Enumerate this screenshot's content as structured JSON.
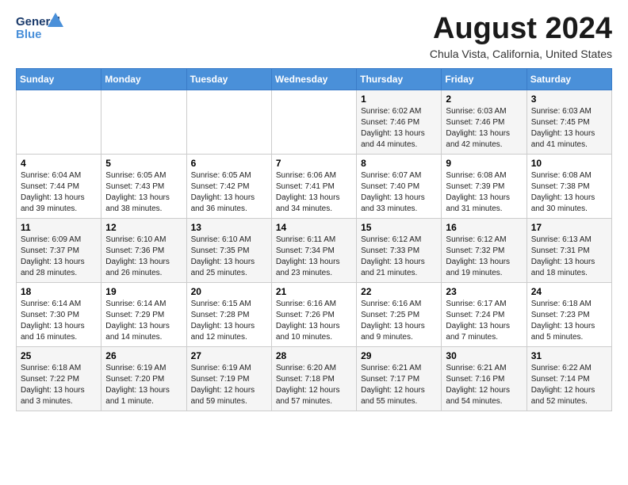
{
  "header": {
    "logo_line1": "General",
    "logo_line2": "Blue",
    "month_title": "August 2024",
    "location": "Chula Vista, California, United States"
  },
  "weekdays": [
    "Sunday",
    "Monday",
    "Tuesday",
    "Wednesday",
    "Thursday",
    "Friday",
    "Saturday"
  ],
  "weeks": [
    [
      {
        "day": "",
        "detail": ""
      },
      {
        "day": "",
        "detail": ""
      },
      {
        "day": "",
        "detail": ""
      },
      {
        "day": "",
        "detail": ""
      },
      {
        "day": "1",
        "detail": "Sunrise: 6:02 AM\nSunset: 7:46 PM\nDaylight: 13 hours\nand 44 minutes."
      },
      {
        "day": "2",
        "detail": "Sunrise: 6:03 AM\nSunset: 7:46 PM\nDaylight: 13 hours\nand 42 minutes."
      },
      {
        "day": "3",
        "detail": "Sunrise: 6:03 AM\nSunset: 7:45 PM\nDaylight: 13 hours\nand 41 minutes."
      }
    ],
    [
      {
        "day": "4",
        "detail": "Sunrise: 6:04 AM\nSunset: 7:44 PM\nDaylight: 13 hours\nand 39 minutes."
      },
      {
        "day": "5",
        "detail": "Sunrise: 6:05 AM\nSunset: 7:43 PM\nDaylight: 13 hours\nand 38 minutes."
      },
      {
        "day": "6",
        "detail": "Sunrise: 6:05 AM\nSunset: 7:42 PM\nDaylight: 13 hours\nand 36 minutes."
      },
      {
        "day": "7",
        "detail": "Sunrise: 6:06 AM\nSunset: 7:41 PM\nDaylight: 13 hours\nand 34 minutes."
      },
      {
        "day": "8",
        "detail": "Sunrise: 6:07 AM\nSunset: 7:40 PM\nDaylight: 13 hours\nand 33 minutes."
      },
      {
        "day": "9",
        "detail": "Sunrise: 6:08 AM\nSunset: 7:39 PM\nDaylight: 13 hours\nand 31 minutes."
      },
      {
        "day": "10",
        "detail": "Sunrise: 6:08 AM\nSunset: 7:38 PM\nDaylight: 13 hours\nand 30 minutes."
      }
    ],
    [
      {
        "day": "11",
        "detail": "Sunrise: 6:09 AM\nSunset: 7:37 PM\nDaylight: 13 hours\nand 28 minutes."
      },
      {
        "day": "12",
        "detail": "Sunrise: 6:10 AM\nSunset: 7:36 PM\nDaylight: 13 hours\nand 26 minutes."
      },
      {
        "day": "13",
        "detail": "Sunrise: 6:10 AM\nSunset: 7:35 PM\nDaylight: 13 hours\nand 25 minutes."
      },
      {
        "day": "14",
        "detail": "Sunrise: 6:11 AM\nSunset: 7:34 PM\nDaylight: 13 hours\nand 23 minutes."
      },
      {
        "day": "15",
        "detail": "Sunrise: 6:12 AM\nSunset: 7:33 PM\nDaylight: 13 hours\nand 21 minutes."
      },
      {
        "day": "16",
        "detail": "Sunrise: 6:12 AM\nSunset: 7:32 PM\nDaylight: 13 hours\nand 19 minutes."
      },
      {
        "day": "17",
        "detail": "Sunrise: 6:13 AM\nSunset: 7:31 PM\nDaylight: 13 hours\nand 18 minutes."
      }
    ],
    [
      {
        "day": "18",
        "detail": "Sunrise: 6:14 AM\nSunset: 7:30 PM\nDaylight: 13 hours\nand 16 minutes."
      },
      {
        "day": "19",
        "detail": "Sunrise: 6:14 AM\nSunset: 7:29 PM\nDaylight: 13 hours\nand 14 minutes."
      },
      {
        "day": "20",
        "detail": "Sunrise: 6:15 AM\nSunset: 7:28 PM\nDaylight: 13 hours\nand 12 minutes."
      },
      {
        "day": "21",
        "detail": "Sunrise: 6:16 AM\nSunset: 7:26 PM\nDaylight: 13 hours\nand 10 minutes."
      },
      {
        "day": "22",
        "detail": "Sunrise: 6:16 AM\nSunset: 7:25 PM\nDaylight: 13 hours\nand 9 minutes."
      },
      {
        "day": "23",
        "detail": "Sunrise: 6:17 AM\nSunset: 7:24 PM\nDaylight: 13 hours\nand 7 minutes."
      },
      {
        "day": "24",
        "detail": "Sunrise: 6:18 AM\nSunset: 7:23 PM\nDaylight: 13 hours\nand 5 minutes."
      }
    ],
    [
      {
        "day": "25",
        "detail": "Sunrise: 6:18 AM\nSunset: 7:22 PM\nDaylight: 13 hours\nand 3 minutes."
      },
      {
        "day": "26",
        "detail": "Sunrise: 6:19 AM\nSunset: 7:20 PM\nDaylight: 13 hours\nand 1 minute."
      },
      {
        "day": "27",
        "detail": "Sunrise: 6:19 AM\nSunset: 7:19 PM\nDaylight: 12 hours\nand 59 minutes."
      },
      {
        "day": "28",
        "detail": "Sunrise: 6:20 AM\nSunset: 7:18 PM\nDaylight: 12 hours\nand 57 minutes."
      },
      {
        "day": "29",
        "detail": "Sunrise: 6:21 AM\nSunset: 7:17 PM\nDaylight: 12 hours\nand 55 minutes."
      },
      {
        "day": "30",
        "detail": "Sunrise: 6:21 AM\nSunset: 7:16 PM\nDaylight: 12 hours\nand 54 minutes."
      },
      {
        "day": "31",
        "detail": "Sunrise: 6:22 AM\nSunset: 7:14 PM\nDaylight: 12 hours\nand 52 minutes."
      }
    ]
  ]
}
